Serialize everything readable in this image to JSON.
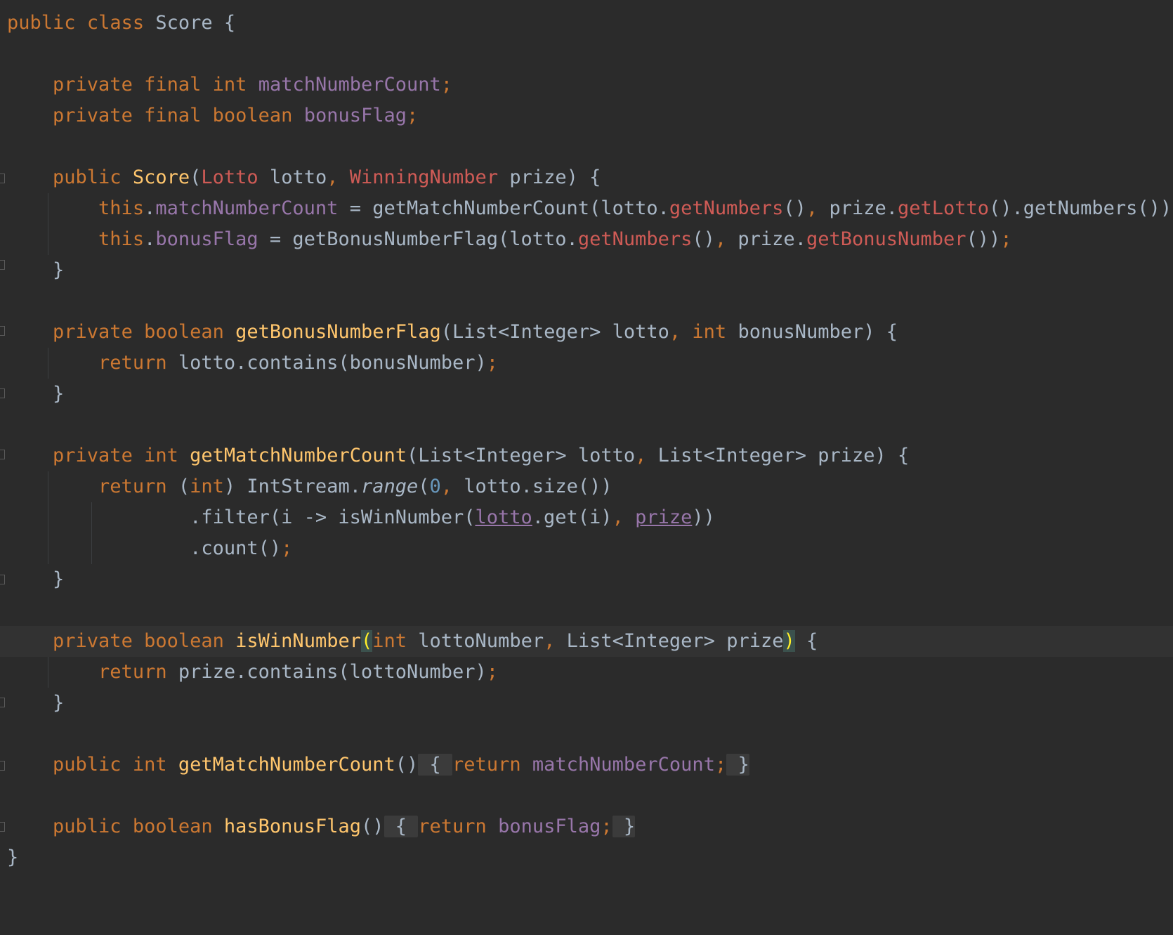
{
  "colors": {
    "background": "#2b2b2b",
    "keyword": "#cc7832",
    "field": "#9876aa",
    "method": "#ffc66d",
    "error": "#cf5b56",
    "number": "#6897bb",
    "text": "#a9b7c6",
    "current_line": "#323232"
  },
  "code": {
    "l1": {
      "public": "public",
      "class": "class",
      "name": "Score",
      "brace": "{"
    },
    "l2": {
      "private": "private",
      "final": "final",
      "type": "int",
      "field": "matchNumberCount",
      "semi": ";"
    },
    "l3": {
      "private": "private",
      "final": "final",
      "type": "boolean",
      "field": "bonusFlag",
      "semi": ";"
    },
    "l4": {
      "public": "public",
      "name": "Score",
      "open": "(",
      "t1": "Lotto",
      "p1": "lotto",
      "comma": ",",
      "t2": "WinningNumber",
      "p2": "prize",
      "close": ") {"
    },
    "l5": {
      "this": "this",
      "dot1": ".",
      "field": "matchNumberCount",
      "eq": " = getMatchNumberCount(lotto.",
      "m1": "getNumbers",
      "mid1": "()",
      "comma": ",",
      "mid2": " prize.",
      "m2": "getLotto",
      "tail": "().getNumbers())",
      "semi": ";"
    },
    "l6": {
      "this": "this",
      "dot1": ".",
      "field": "bonusFlag",
      "eq": " = getBonusNumberFlag(lotto.",
      "m1": "getNumbers",
      "mid1": "()",
      "comma": ",",
      "mid2": " prize.",
      "m2": "getBonusNumber",
      "tail": "())",
      "semi": ";"
    },
    "l7": {
      "brace": "}"
    },
    "l8": {
      "private": "private",
      "type": "boolean",
      "name": "getBonusNumberFlag",
      "p1": "(List<Integer> lotto",
      "comma": ",",
      "t2": "int",
      "p2": " bonusNumber) {"
    },
    "l9": {
      "return": "return",
      "body": " lotto.contains(bonusNumber)",
      "semi": ";"
    },
    "l10": {
      "brace": "}"
    },
    "l11": {
      "private": "private",
      "type": "int",
      "name": "getMatchNumberCount",
      "p1": "(List<Integer> lotto",
      "comma": ",",
      "p2": " List<Integer> prize) {"
    },
    "l12": {
      "return": "return",
      "open": " (",
      "cast": "int",
      "mid": ") IntStream.",
      "range": "range",
      "paren": "(",
      "zero": "0",
      "comma": ",",
      "tail": " lotto.size())"
    },
    "l13": {
      "head": ".filter(i -> isWinNumber(",
      "lotto": "lotto",
      "mid": ".get(i)",
      "comma": ",",
      "sp": " ",
      "prize": "prize",
      "tail": "))"
    },
    "l14": {
      "head": ".count()",
      "semi": ";"
    },
    "l15": {
      "brace": "}"
    },
    "l16": {
      "private": "private",
      "type": "boolean",
      "name": "isWinNumber",
      "open": "(",
      "t1": "int",
      "p1": " lottoNumber",
      "comma": ",",
      "p2": " List<Integer> prize",
      "close": ")",
      "brace": " {"
    },
    "l17": {
      "return": "return",
      "body": " prize.contains(lottoNumber)",
      "semi": ";"
    },
    "l18": {
      "brace": "}"
    },
    "l19": {
      "public": "public",
      "type": "int",
      "name": "getMatchNumberCount",
      "parens": "()",
      "fold_open": " { ",
      "return": "return",
      "field": "matchNumberCount",
      "semi": ";",
      "fold_close": " }"
    },
    "l20": {
      "public": "public",
      "type": "boolean",
      "name": "hasBonusFlag",
      "parens": "()",
      "fold_open": " { ",
      "return": "return",
      "field": "bonusFlag",
      "semi": ";",
      "fold_close": " }"
    },
    "l21": {
      "brace": "}"
    }
  }
}
